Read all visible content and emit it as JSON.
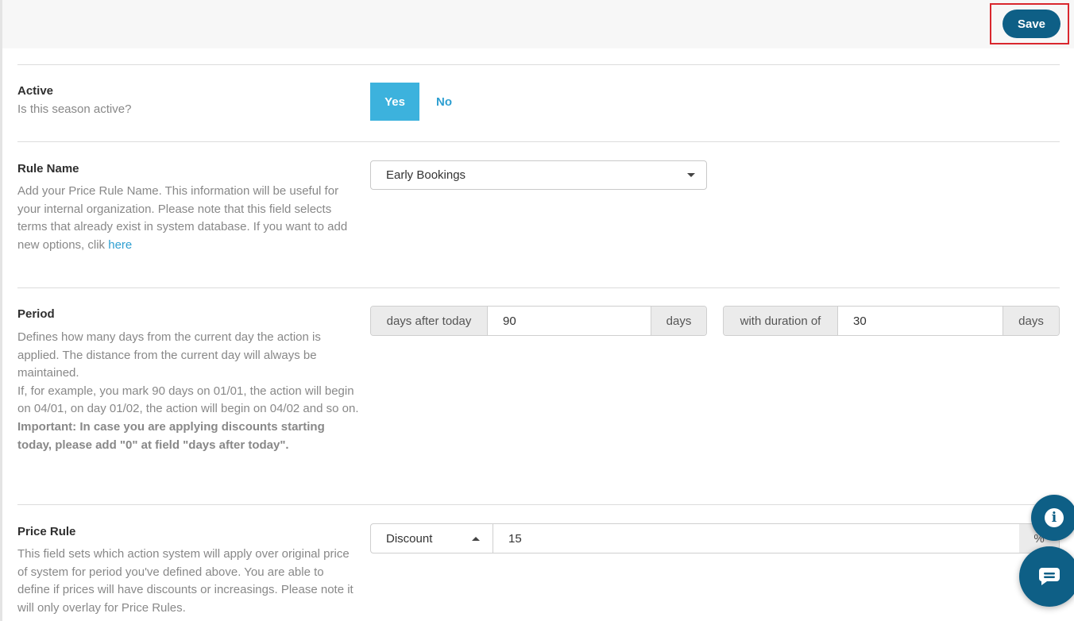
{
  "toolbar": {
    "save_label": "Save"
  },
  "active": {
    "label": "Active",
    "description": "Is this season active?",
    "yes_label": "Yes",
    "no_label": "No",
    "selected": "Yes"
  },
  "rule_name": {
    "label": "Rule Name",
    "description": "Add your Price Rule Name. This information will be useful for your internal organization. Please note that this field selects terms that already exist in system database. If you want to add new options, clik",
    "link_text": "here",
    "selected_value": "Early Bookings"
  },
  "period": {
    "label": "Period",
    "description_1": "Defines how many days from the current day the action is applied. The distance from the current day will always be maintained.",
    "description_2": "If, for example, you mark 90 days on 01/01, the action will begin on 04/01, on day 01/02, the action will begin on 04/02 and so on.",
    "important": "Important: In case you are applying discounts starting today, please add \"0\" at field \"days after today\".",
    "after_prefix": "days after today",
    "after_value": "90",
    "after_suffix": "days",
    "duration_prefix": "with duration of",
    "duration_value": "30",
    "duration_suffix": "days"
  },
  "price_rule": {
    "label": "Price Rule",
    "description": "This field sets which action system will apply over original price of system for period you've defined above. You are able to define if prices will have discounts or increasings. Please note it will only overlay for Price Rules.",
    "type_value": "Discount",
    "amount_value": "15",
    "unit": "%"
  },
  "icons": {
    "info": "info-icon",
    "chat": "chat-icon",
    "dropdown": "caret-down-icon"
  },
  "colors": {
    "primary": "#0e5f86",
    "toggle_active": "#3cb2dd",
    "link": "#2e9fd1",
    "highlight_border": "#d9272e"
  }
}
